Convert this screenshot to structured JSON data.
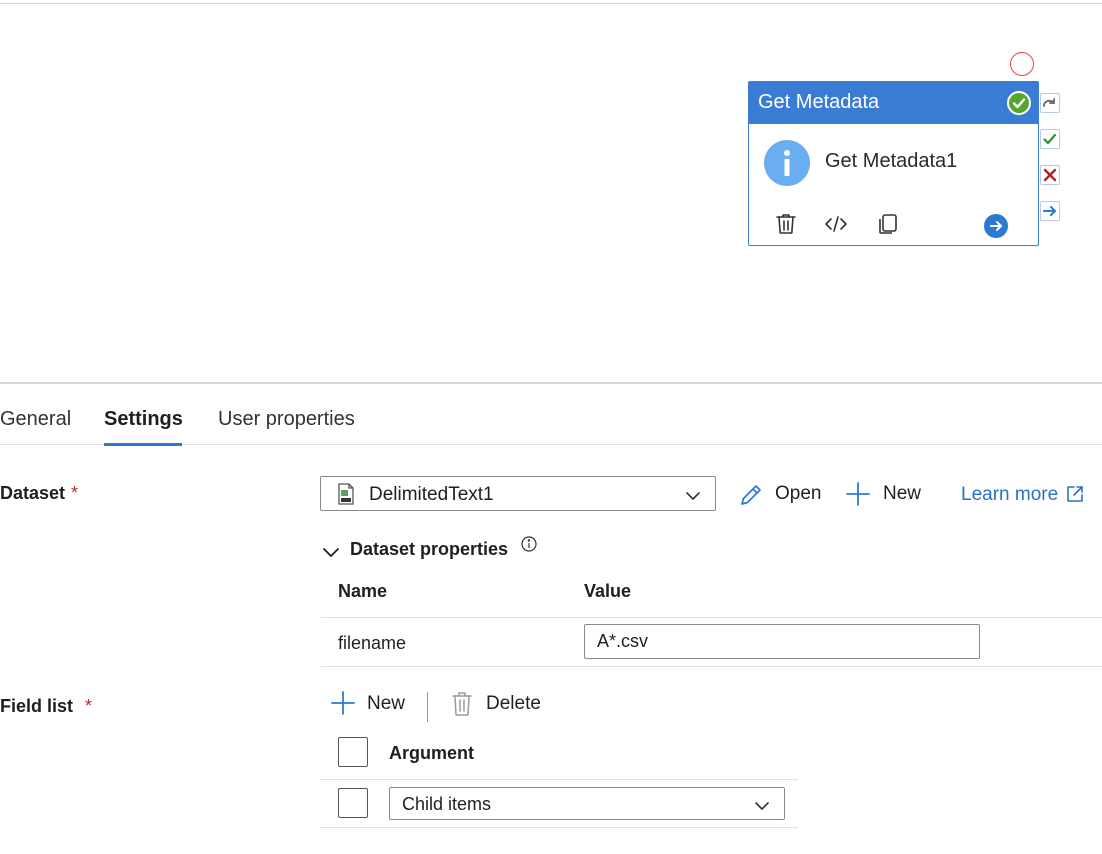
{
  "node": {
    "title": "Get Metadata",
    "name": "Get Metadata1",
    "header_color": "#3a7cd3",
    "status": "succeeded",
    "icons": [
      "delete-icon",
      "code-icon",
      "copy-icon",
      "go-arrow-icon"
    ],
    "side_buttons": [
      "on-completion-icon",
      "on-success-icon",
      "on-failure-icon",
      "on-skip-icon"
    ]
  },
  "tabs": [
    {
      "label": "General"
    },
    {
      "label": "Settings",
      "active": true
    },
    {
      "label": "User properties"
    }
  ],
  "dataset": {
    "label": "Dataset",
    "required_mark": "*",
    "selected": "DelimitedText1",
    "open_label": "Open",
    "new_label": "New",
    "learn_more_label": "Learn more",
    "properties_label": "Dataset properties",
    "table": {
      "headers": {
        "name": "Name",
        "value": "Value"
      },
      "rows": [
        {
          "name": "filename",
          "value": "A*.csv"
        }
      ]
    }
  },
  "field_list": {
    "label": "Field list",
    "required_mark": "*",
    "new_label": "New",
    "delete_label": "Delete",
    "header": "Argument",
    "rows": [
      {
        "value": "Child items"
      }
    ]
  },
  "colors": {
    "accent": "#2b79d3",
    "link": "#2b6fc7",
    "success": "#57a52c",
    "failure": "#b22222",
    "required": "#c4262e"
  }
}
